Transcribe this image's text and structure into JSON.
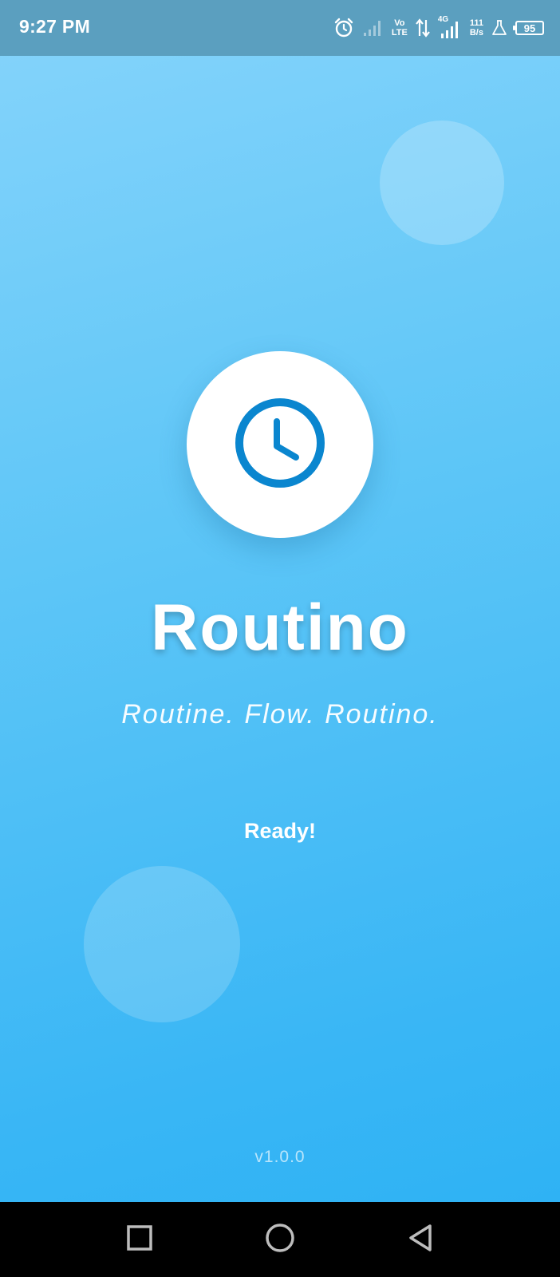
{
  "status_bar": {
    "time": "9:27 PM",
    "volte_line1": "Vo",
    "volte_line2": "LTE",
    "network_type": "4G",
    "speed_value": "111",
    "speed_unit": "B/s",
    "battery_level": "95",
    "icons": [
      "alarm-icon",
      "signal-icon",
      "volte-icon",
      "data-arrows-icon",
      "signal-4g-icon",
      "flask-icon",
      "battery-icon"
    ]
  },
  "splash": {
    "app_name": "Routino",
    "tagline": "Routine. Flow. Routino.",
    "status": "Ready!",
    "version": "v1.0.0",
    "logo_icon": "clock-icon"
  },
  "nav_bar": {
    "icons": [
      "recent-apps-icon",
      "home-icon",
      "back-icon"
    ]
  },
  "colors": {
    "background_top": "#86d4fb",
    "background_bottom": "#2bb1f4",
    "status_bar": "#5b9fbf",
    "clock_blue": "#0a86cf",
    "text": "#ffffff"
  }
}
